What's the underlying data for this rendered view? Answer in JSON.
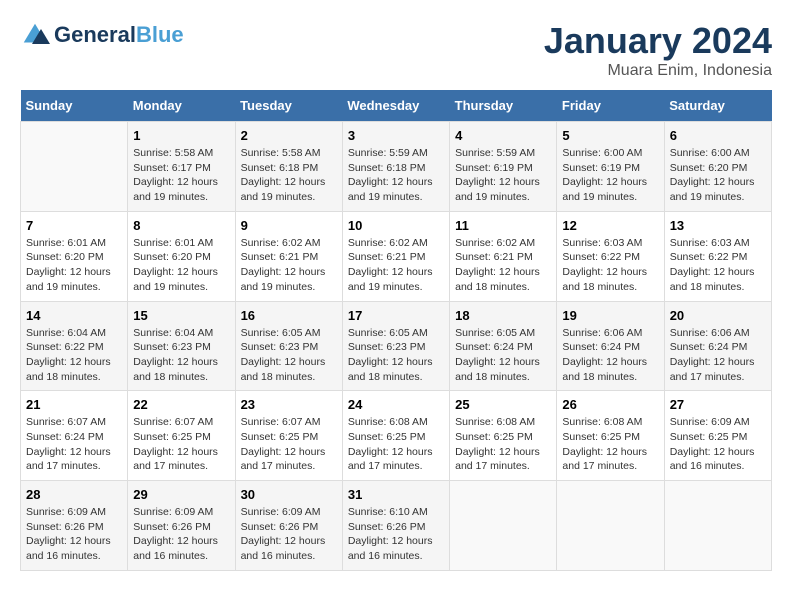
{
  "logo": {
    "line1": "General",
    "line2": "Blue"
  },
  "title": "January 2024",
  "subtitle": "Muara Enim, Indonesia",
  "columns": [
    "Sunday",
    "Monday",
    "Tuesday",
    "Wednesday",
    "Thursday",
    "Friday",
    "Saturday"
  ],
  "weeks": [
    [
      {
        "day": "",
        "sunrise": "",
        "sunset": "",
        "daylight": ""
      },
      {
        "day": "1",
        "sunrise": "Sunrise: 5:58 AM",
        "sunset": "Sunset: 6:17 PM",
        "daylight": "Daylight: 12 hours and 19 minutes."
      },
      {
        "day": "2",
        "sunrise": "Sunrise: 5:58 AM",
        "sunset": "Sunset: 6:18 PM",
        "daylight": "Daylight: 12 hours and 19 minutes."
      },
      {
        "day": "3",
        "sunrise": "Sunrise: 5:59 AM",
        "sunset": "Sunset: 6:18 PM",
        "daylight": "Daylight: 12 hours and 19 minutes."
      },
      {
        "day": "4",
        "sunrise": "Sunrise: 5:59 AM",
        "sunset": "Sunset: 6:19 PM",
        "daylight": "Daylight: 12 hours and 19 minutes."
      },
      {
        "day": "5",
        "sunrise": "Sunrise: 6:00 AM",
        "sunset": "Sunset: 6:19 PM",
        "daylight": "Daylight: 12 hours and 19 minutes."
      },
      {
        "day": "6",
        "sunrise": "Sunrise: 6:00 AM",
        "sunset": "Sunset: 6:20 PM",
        "daylight": "Daylight: 12 hours and 19 minutes."
      }
    ],
    [
      {
        "day": "7",
        "sunrise": "Sunrise: 6:01 AM",
        "sunset": "Sunset: 6:20 PM",
        "daylight": "Daylight: 12 hours and 19 minutes."
      },
      {
        "day": "8",
        "sunrise": "Sunrise: 6:01 AM",
        "sunset": "Sunset: 6:20 PM",
        "daylight": "Daylight: 12 hours and 19 minutes."
      },
      {
        "day": "9",
        "sunrise": "Sunrise: 6:02 AM",
        "sunset": "Sunset: 6:21 PM",
        "daylight": "Daylight: 12 hours and 19 minutes."
      },
      {
        "day": "10",
        "sunrise": "Sunrise: 6:02 AM",
        "sunset": "Sunset: 6:21 PM",
        "daylight": "Daylight: 12 hours and 19 minutes."
      },
      {
        "day": "11",
        "sunrise": "Sunrise: 6:02 AM",
        "sunset": "Sunset: 6:21 PM",
        "daylight": "Daylight: 12 hours and 18 minutes."
      },
      {
        "day": "12",
        "sunrise": "Sunrise: 6:03 AM",
        "sunset": "Sunset: 6:22 PM",
        "daylight": "Daylight: 12 hours and 18 minutes."
      },
      {
        "day": "13",
        "sunrise": "Sunrise: 6:03 AM",
        "sunset": "Sunset: 6:22 PM",
        "daylight": "Daylight: 12 hours and 18 minutes."
      }
    ],
    [
      {
        "day": "14",
        "sunrise": "Sunrise: 6:04 AM",
        "sunset": "Sunset: 6:22 PM",
        "daylight": "Daylight: 12 hours and 18 minutes."
      },
      {
        "day": "15",
        "sunrise": "Sunrise: 6:04 AM",
        "sunset": "Sunset: 6:23 PM",
        "daylight": "Daylight: 12 hours and 18 minutes."
      },
      {
        "day": "16",
        "sunrise": "Sunrise: 6:05 AM",
        "sunset": "Sunset: 6:23 PM",
        "daylight": "Daylight: 12 hours and 18 minutes."
      },
      {
        "day": "17",
        "sunrise": "Sunrise: 6:05 AM",
        "sunset": "Sunset: 6:23 PM",
        "daylight": "Daylight: 12 hours and 18 minutes."
      },
      {
        "day": "18",
        "sunrise": "Sunrise: 6:05 AM",
        "sunset": "Sunset: 6:24 PM",
        "daylight": "Daylight: 12 hours and 18 minutes."
      },
      {
        "day": "19",
        "sunrise": "Sunrise: 6:06 AM",
        "sunset": "Sunset: 6:24 PM",
        "daylight": "Daylight: 12 hours and 18 minutes."
      },
      {
        "day": "20",
        "sunrise": "Sunrise: 6:06 AM",
        "sunset": "Sunset: 6:24 PM",
        "daylight": "Daylight: 12 hours and 17 minutes."
      }
    ],
    [
      {
        "day": "21",
        "sunrise": "Sunrise: 6:07 AM",
        "sunset": "Sunset: 6:24 PM",
        "daylight": "Daylight: 12 hours and 17 minutes."
      },
      {
        "day": "22",
        "sunrise": "Sunrise: 6:07 AM",
        "sunset": "Sunset: 6:25 PM",
        "daylight": "Daylight: 12 hours and 17 minutes."
      },
      {
        "day": "23",
        "sunrise": "Sunrise: 6:07 AM",
        "sunset": "Sunset: 6:25 PM",
        "daylight": "Daylight: 12 hours and 17 minutes."
      },
      {
        "day": "24",
        "sunrise": "Sunrise: 6:08 AM",
        "sunset": "Sunset: 6:25 PM",
        "daylight": "Daylight: 12 hours and 17 minutes."
      },
      {
        "day": "25",
        "sunrise": "Sunrise: 6:08 AM",
        "sunset": "Sunset: 6:25 PM",
        "daylight": "Daylight: 12 hours and 17 minutes."
      },
      {
        "day": "26",
        "sunrise": "Sunrise: 6:08 AM",
        "sunset": "Sunset: 6:25 PM",
        "daylight": "Daylight: 12 hours and 17 minutes."
      },
      {
        "day": "27",
        "sunrise": "Sunrise: 6:09 AM",
        "sunset": "Sunset: 6:25 PM",
        "daylight": "Daylight: 12 hours and 16 minutes."
      }
    ],
    [
      {
        "day": "28",
        "sunrise": "Sunrise: 6:09 AM",
        "sunset": "Sunset: 6:26 PM",
        "daylight": "Daylight: 12 hours and 16 minutes."
      },
      {
        "day": "29",
        "sunrise": "Sunrise: 6:09 AM",
        "sunset": "Sunset: 6:26 PM",
        "daylight": "Daylight: 12 hours and 16 minutes."
      },
      {
        "day": "30",
        "sunrise": "Sunrise: 6:09 AM",
        "sunset": "Sunset: 6:26 PM",
        "daylight": "Daylight: 12 hours and 16 minutes."
      },
      {
        "day": "31",
        "sunrise": "Sunrise: 6:10 AM",
        "sunset": "Sunset: 6:26 PM",
        "daylight": "Daylight: 12 hours and 16 minutes."
      },
      {
        "day": "",
        "sunrise": "",
        "sunset": "",
        "daylight": ""
      },
      {
        "day": "",
        "sunrise": "",
        "sunset": "",
        "daylight": ""
      },
      {
        "day": "",
        "sunrise": "",
        "sunset": "",
        "daylight": ""
      }
    ]
  ]
}
